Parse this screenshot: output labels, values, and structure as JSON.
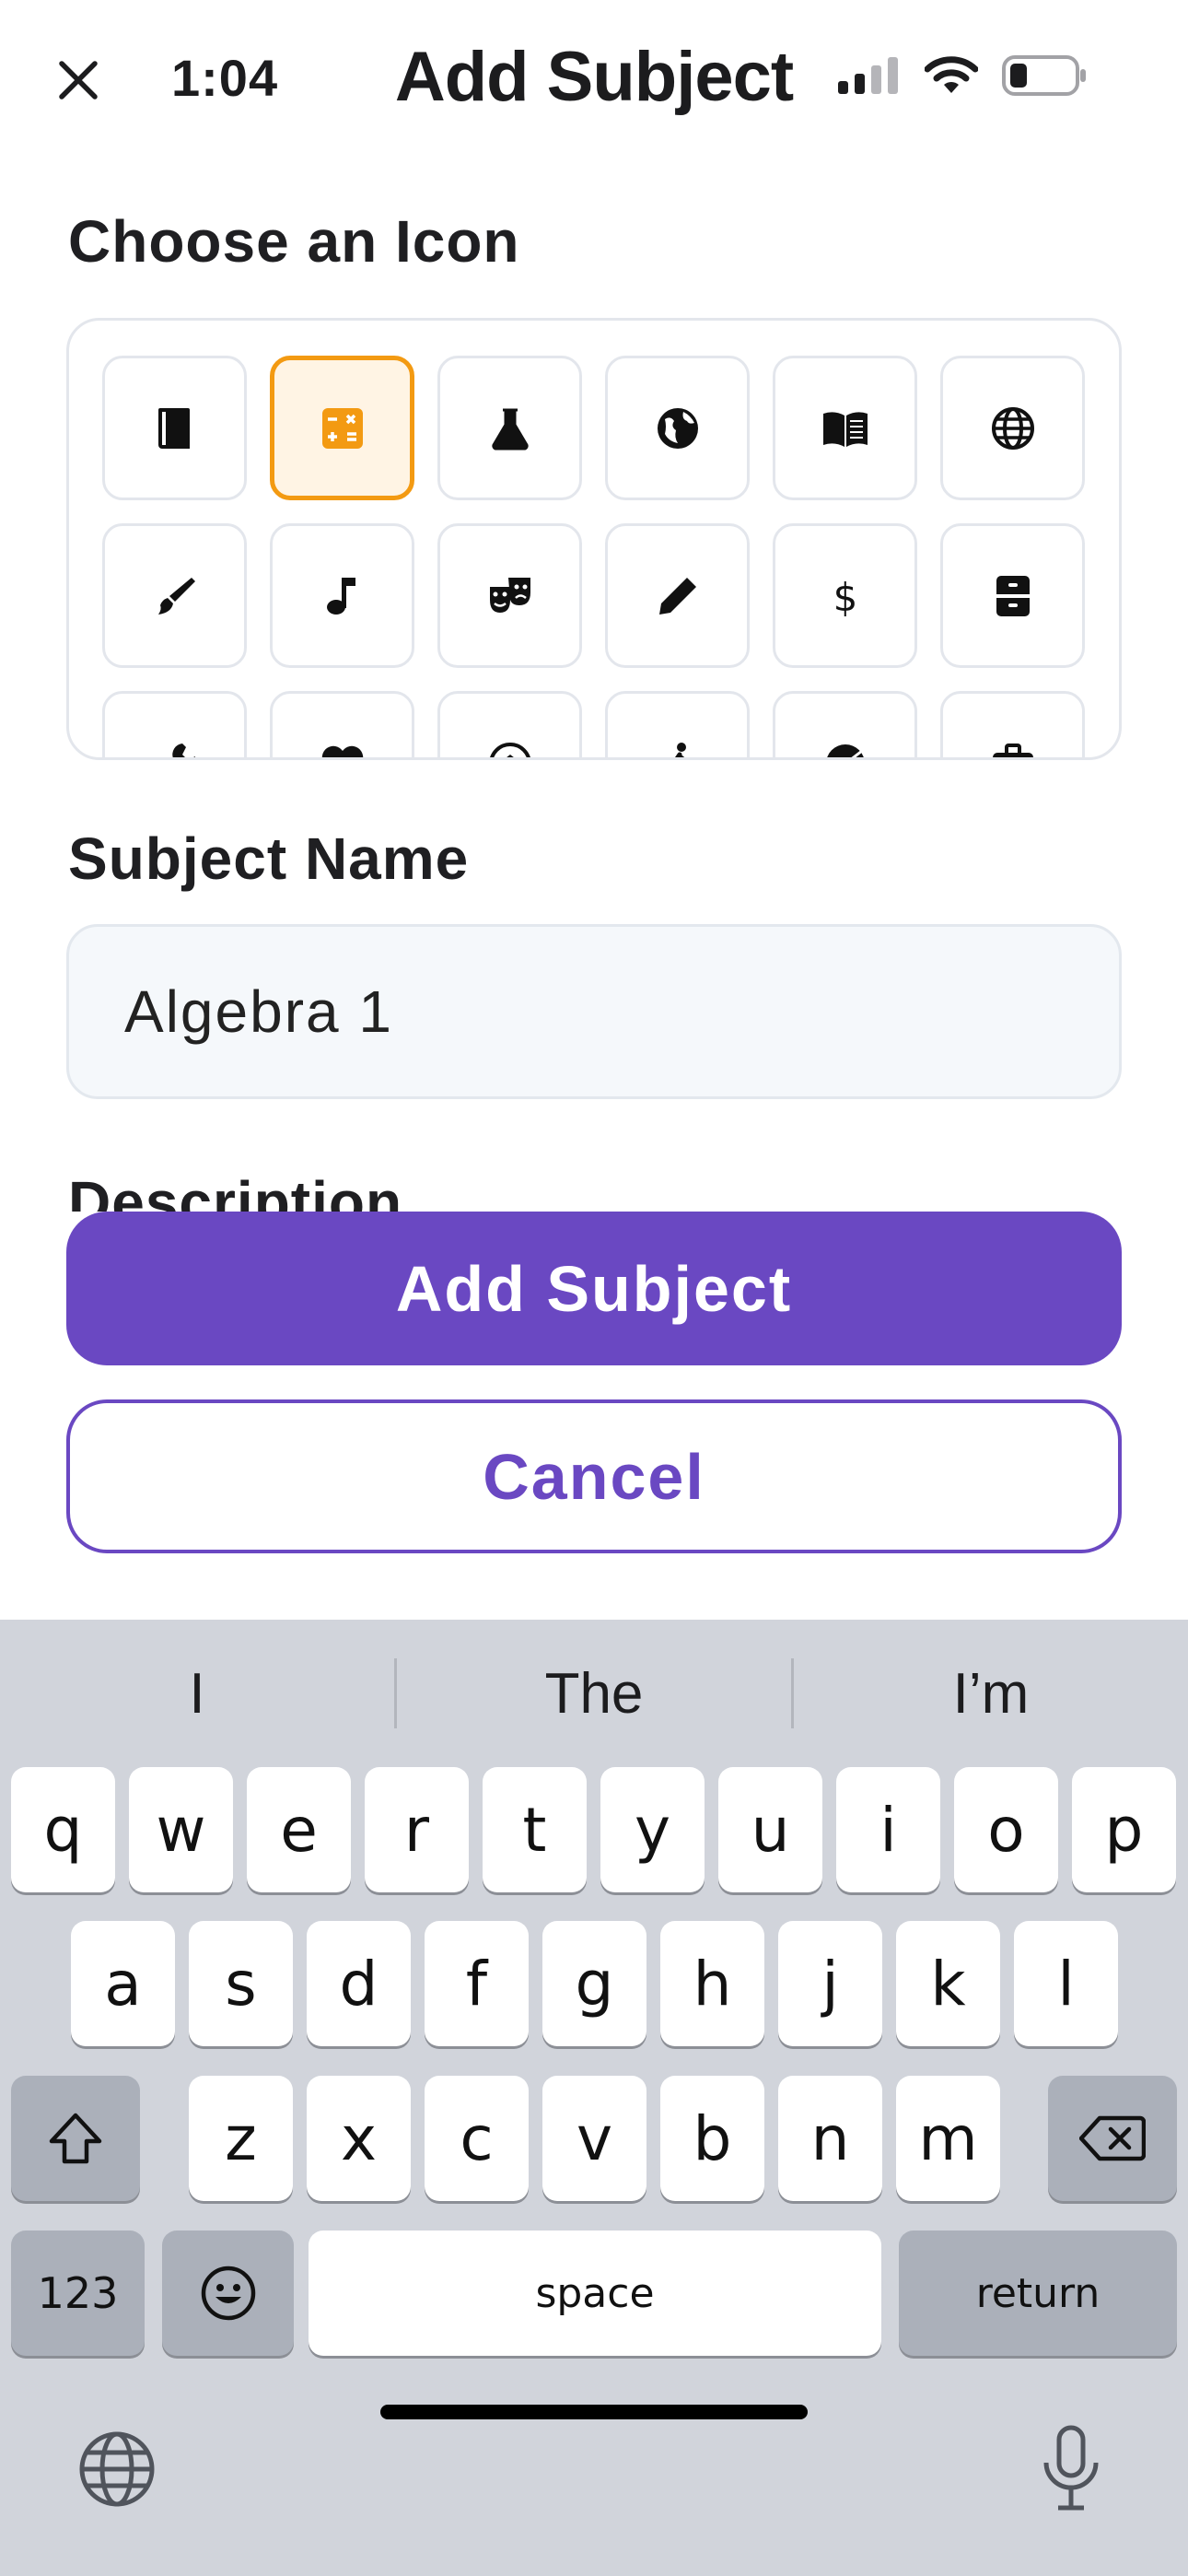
{
  "header": {
    "time": "1:04",
    "title": "Add Subject"
  },
  "icon_picker": {
    "label": "Choose an Icon",
    "selected_index": 1,
    "accent_color": "#f39a12",
    "icons": [
      "book-icon",
      "calculator-icon",
      "flask-icon",
      "globe-americas-icon",
      "open-book-icon",
      "globe-grid-icon",
      "paintbrush-icon",
      "music-note-icon",
      "theater-masks-icon",
      "pencil-icon",
      "dollar-icon",
      "cabinet-icon",
      "wrench-icon",
      "heart-icon",
      "soccer-ball-icon",
      "person-running-icon",
      "pie-chart-icon",
      "briefcase-icon"
    ]
  },
  "subject_name": {
    "label": "Subject Name",
    "value": "Algebra 1"
  },
  "description": {
    "label": "Description"
  },
  "buttons": {
    "primary": "Add Subject",
    "secondary": "Cancel",
    "brand_color": "#6a48c2"
  },
  "keyboard": {
    "suggestions": [
      "I",
      "The",
      "I’m"
    ],
    "row1": [
      "q",
      "w",
      "e",
      "r",
      "t",
      "y",
      "u",
      "i",
      "o",
      "p"
    ],
    "row2": [
      "a",
      "s",
      "d",
      "f",
      "g",
      "h",
      "j",
      "k",
      "l"
    ],
    "row3": [
      "z",
      "x",
      "c",
      "v",
      "b",
      "n",
      "m"
    ],
    "numbers_key": "123",
    "space_key": "space",
    "return_key": "return"
  }
}
